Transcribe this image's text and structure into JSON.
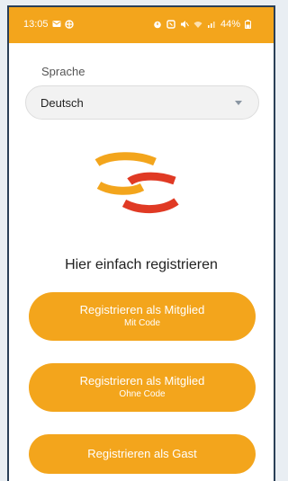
{
  "status_bar": {
    "time": "13:05",
    "battery": "44%",
    "background_color": "#f3a51c"
  },
  "language": {
    "label": "Sprache",
    "selected": "Deutsch"
  },
  "logo": {
    "colors": [
      "#f3a51c",
      "#e03a24"
    ]
  },
  "headline": "Hier einfach registrieren",
  "buttons": {
    "member_with_code": {
      "title": "Registrieren als Mitglied",
      "subtitle": "Mit Code"
    },
    "member_without_code": {
      "title": "Registrieren als Mitglied",
      "subtitle": "Ohne Code"
    },
    "guest": {
      "title": "Registrieren als Gast"
    }
  },
  "accent_color": "#f3a51c"
}
